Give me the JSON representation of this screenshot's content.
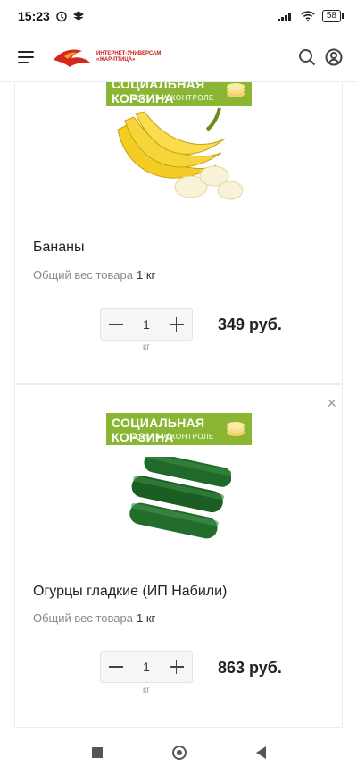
{
  "status_bar": {
    "time": "15:23",
    "battery": "58"
  },
  "header": {
    "logo_line1": "ИНТЕРНЕТ-УНИВЕРСАМ",
    "logo_line2": "«ЖАР-ПТИЦА»"
  },
  "banner": {
    "title": "СОЦИАЛЬНАЯ КОРЗИНА",
    "subtitle": "ЦЕНА НА КОНТРОЛЕ"
  },
  "products": [
    {
      "name": "Бананы",
      "weight_label": "Общий вес товара",
      "weight_value": "1 кг",
      "qty": "1",
      "unit": "кг",
      "price": "349 руб."
    },
    {
      "name": "Огурцы гладкие (ИП Набили)",
      "weight_label": "Общий вес товара",
      "weight_value": "1 кг",
      "qty": "1",
      "unit": "кг",
      "price": "863 руб.",
      "remove": "×"
    }
  ],
  "colors": {
    "banner_green": "#8ab634",
    "brand_red": "#c2231b"
  }
}
